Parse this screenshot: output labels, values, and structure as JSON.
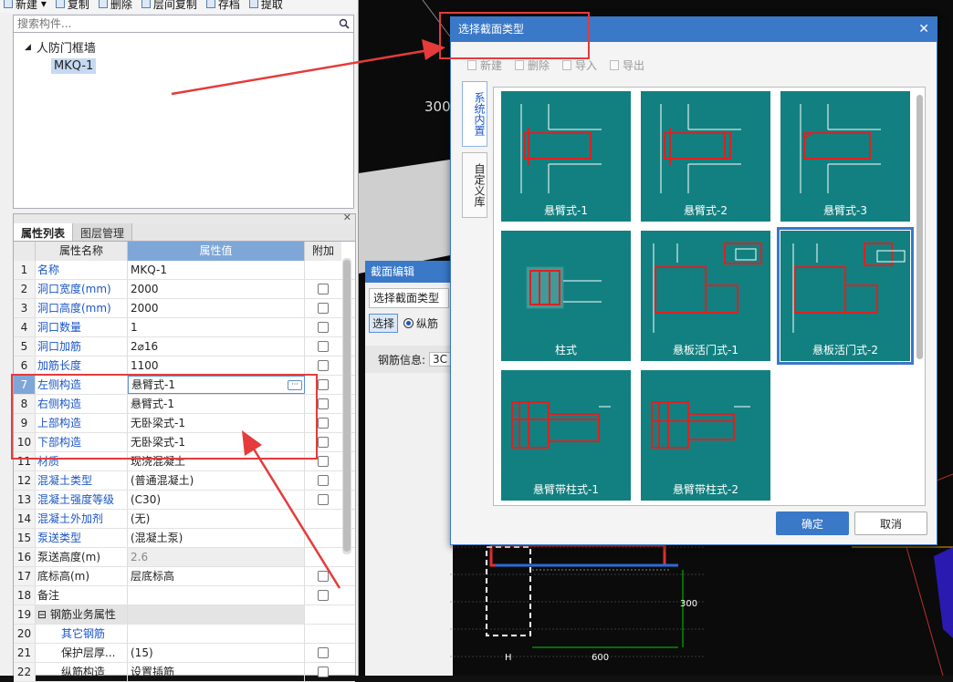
{
  "toolbar": {
    "items": [
      {
        "label": "新建",
        "icon": "new-icon"
      },
      {
        "label": "复制",
        "icon": "copy-icon"
      },
      {
        "label": "删除",
        "icon": "delete-icon"
      },
      {
        "label": "层间复制",
        "icon": "layer-copy-icon"
      },
      {
        "label": "存档",
        "icon": "save-icon"
      },
      {
        "label": "提取",
        "icon": "extract-icon"
      }
    ]
  },
  "search": {
    "placeholder": "搜索构件..."
  },
  "tree": {
    "root": "人防门框墙",
    "child": "MKQ-1"
  },
  "props": {
    "tabs": [
      "属性列表",
      "图层管理"
    ],
    "headers": [
      "属性名称",
      "属性值",
      "附加"
    ],
    "rows": [
      {
        "n": "1",
        "name": "名称",
        "value": "MKQ-1",
        "blue": true,
        "cb": false
      },
      {
        "n": "2",
        "name": "洞口宽度(mm)",
        "value": "2000",
        "blue": true,
        "cb": true
      },
      {
        "n": "3",
        "name": "洞口高度(mm)",
        "value": "2000",
        "blue": true,
        "cb": true
      },
      {
        "n": "4",
        "name": "洞口数量",
        "value": "1",
        "blue": true,
        "cb": true
      },
      {
        "n": "5",
        "name": "洞口加筋",
        "value": "2⌀16",
        "blue": true,
        "cb": true
      },
      {
        "n": "6",
        "name": "加筋长度",
        "value": "1100",
        "blue": true,
        "cb": true
      },
      {
        "n": "7",
        "name": "左侧构造",
        "value": "悬臂式-1",
        "blue": true,
        "cb": true,
        "sel": true
      },
      {
        "n": "8",
        "name": "右侧构造",
        "value": "悬臂式-1",
        "blue": true,
        "cb": true
      },
      {
        "n": "9",
        "name": "上部构造",
        "value": "无卧梁式-1",
        "blue": true,
        "cb": true
      },
      {
        "n": "10",
        "name": "下部构造",
        "value": "无卧梁式-1",
        "blue": true,
        "cb": true
      },
      {
        "n": "11",
        "name": "材质",
        "value": "现浇混凝土",
        "blue": true,
        "cb": true
      },
      {
        "n": "12",
        "name": "混凝土类型",
        "value": "(普通混凝土)",
        "blue": true,
        "cb": true
      },
      {
        "n": "13",
        "name": "混凝土强度等级",
        "value": "(C30)",
        "blue": true,
        "cb": true
      },
      {
        "n": "14",
        "name": "混凝土外加剂",
        "value": "(无)",
        "blue": true,
        "cb": false
      },
      {
        "n": "15",
        "name": "泵送类型",
        "value": "(混凝土泵)",
        "blue": true,
        "cb": false
      },
      {
        "n": "16",
        "name": "泵送高度(m)",
        "value": "2.6",
        "blue": false,
        "cb": false,
        "gray": true
      },
      {
        "n": "17",
        "name": "底标高(m)",
        "value": "层底标高",
        "blue": false,
        "cb": true
      },
      {
        "n": "18",
        "name": "备注",
        "value": "",
        "blue": false,
        "cb": true
      },
      {
        "n": "19",
        "name": "⊟ 钢筋业务属性",
        "value": "",
        "blue": false,
        "cb": false,
        "grp": true
      },
      {
        "n": "20",
        "name": "其它钢筋",
        "value": "",
        "blue": true,
        "cb": false,
        "indent": true
      },
      {
        "n": "21",
        "name": "保护层厚...",
        "value": "(15)",
        "blue": false,
        "cb": true,
        "indent": true
      },
      {
        "n": "22",
        "name": "纵筋构造",
        "value": "设置插筋",
        "blue": false,
        "cb": true,
        "indent": true
      }
    ]
  },
  "section_editor": {
    "title": "截面编辑",
    "select_type": "选择截面类型",
    "select_btn": "选择",
    "radio_label": "纵筋",
    "info_label": "钢筋信息:",
    "info_value": "3C"
  },
  "canvas": {
    "label_300_top": "300",
    "label_300_bottom": "300",
    "label_600": "600",
    "label_h": "H"
  },
  "dialog": {
    "title": "选择截面类型",
    "toolbar": [
      {
        "label": "新建",
        "icon": "new-icon"
      },
      {
        "label": "删除",
        "icon": "delete-icon"
      },
      {
        "label": "导入",
        "icon": "import-icon"
      },
      {
        "label": "导出",
        "icon": "export-icon"
      }
    ],
    "side_tabs": [
      "系统内置",
      "自定义库"
    ],
    "tiles": [
      "悬臂式-1",
      "悬臂式-2",
      "悬臂式-3",
      "柱式",
      "悬板活门式-1",
      "悬板活门式-2",
      "悬臂带柱式-1",
      "悬臂带柱式-2"
    ],
    "selected_tile": "悬板活门式-2",
    "ok": "确定",
    "cancel": "取消"
  },
  "colors": {
    "accent": "#3a78c8",
    "tile": "#128080",
    "annotation": "#e53b3b",
    "rebar": "#e02020"
  }
}
